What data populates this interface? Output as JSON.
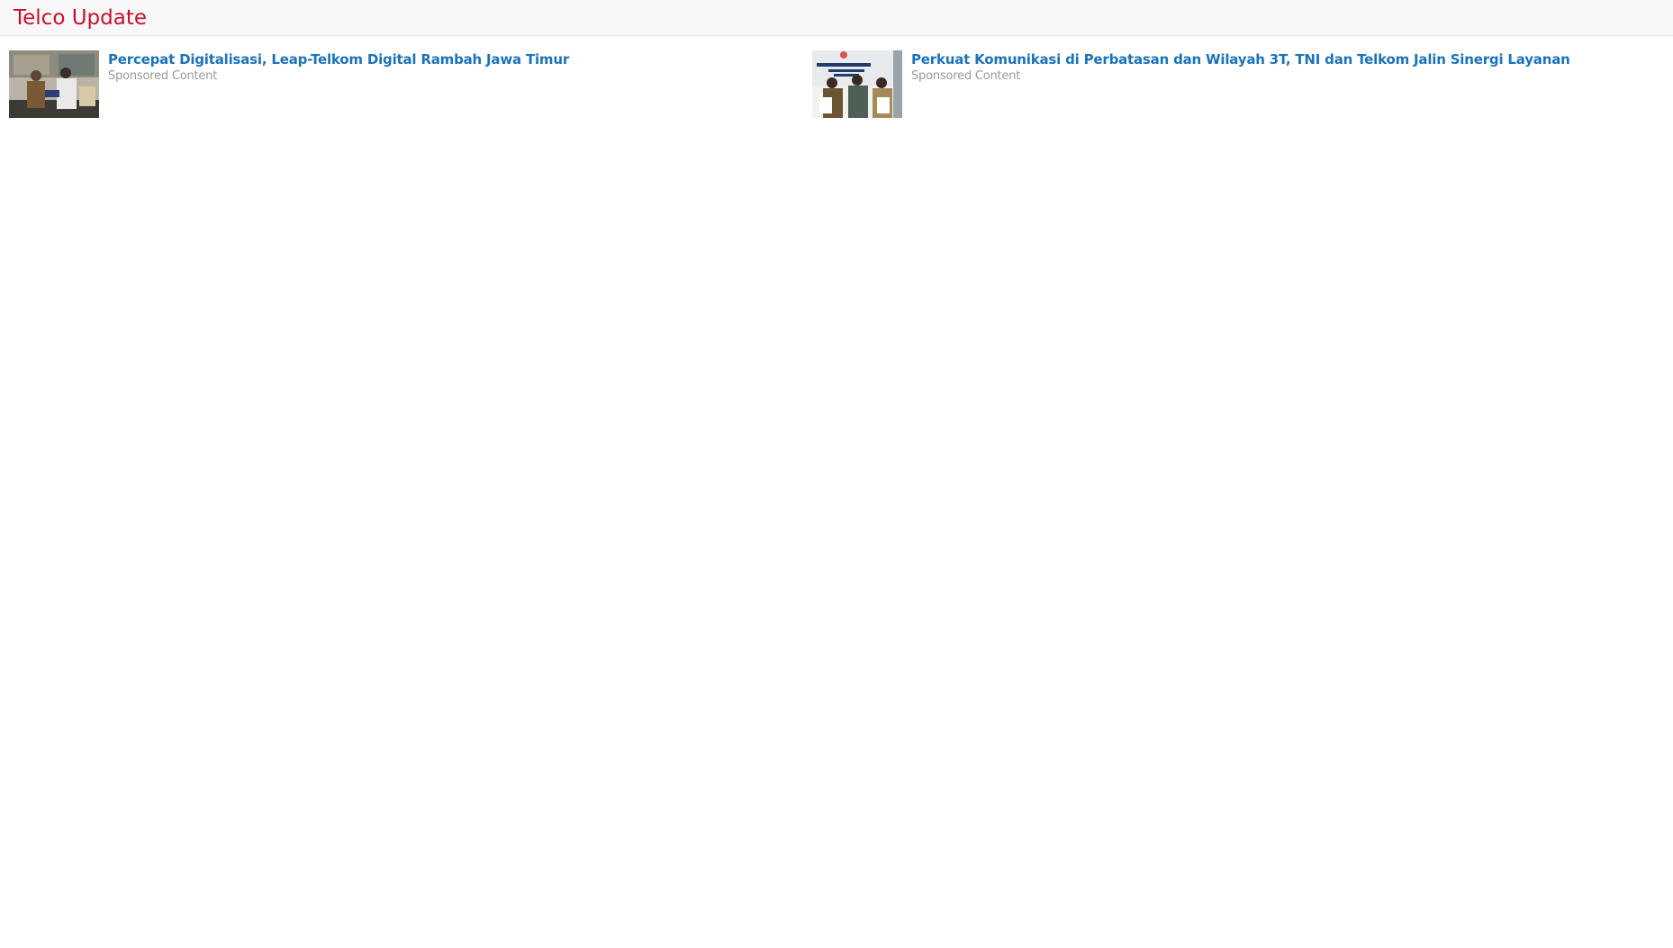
{
  "header": {
    "title": "Telco Update"
  },
  "items": [
    {
      "title": "Percepat Digitalisasi, Leap-Telkom Digital Rambah Jawa Timur",
      "label": "Sponsored Content",
      "thumbnail_icon": "news-thumbnail-image"
    },
    {
      "title": "Perkuat Komunikasi di Perbatasan dan Wilayah 3T, TNI dan Telkom Jalin Sinergi Layanan",
      "label": "Sponsored Content",
      "thumbnail_icon": "news-thumbnail-image"
    }
  ],
  "colors": {
    "header_title": "#c8102e",
    "link": "#1c73b8",
    "meta": "#999999",
    "header_bg": "#f8f8f8"
  }
}
